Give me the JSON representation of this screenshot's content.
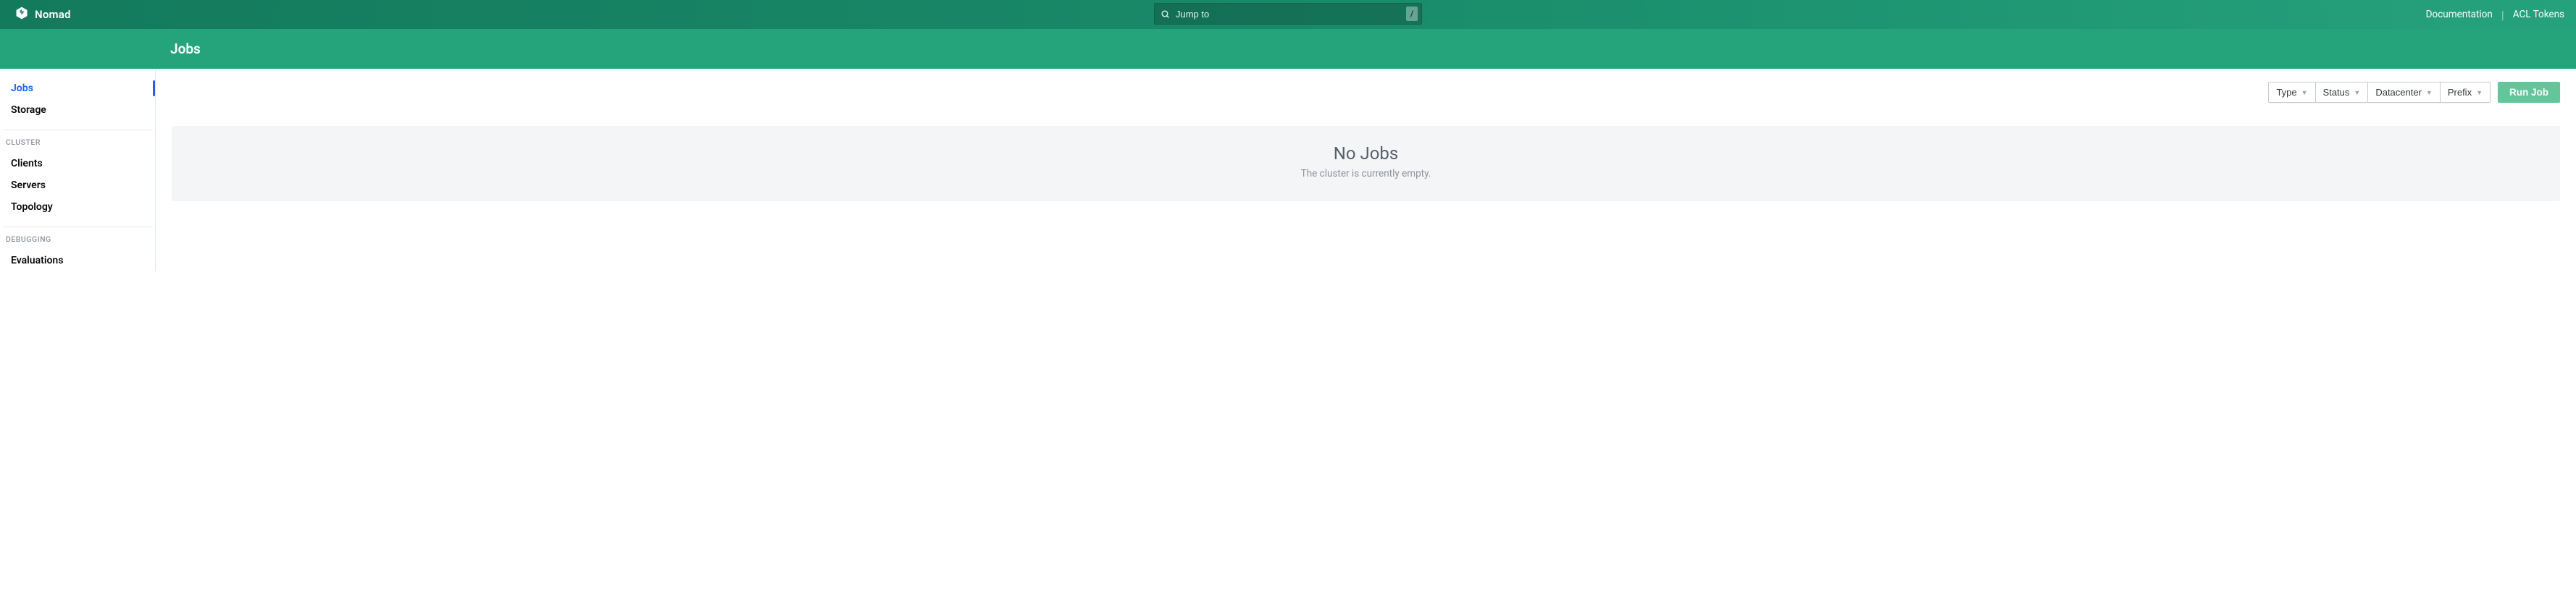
{
  "brand": {
    "name": "Nomad"
  },
  "search": {
    "placeholder": "Jump to",
    "value": "",
    "shortcut": "/"
  },
  "topnav_links": {
    "docs": "Documentation",
    "acl": "ACL Tokens"
  },
  "page": {
    "title": "Jobs"
  },
  "sidebar": {
    "workloads": [
      {
        "label": "Jobs",
        "active": true
      },
      {
        "label": "Storage",
        "active": false
      }
    ],
    "cluster_heading": "CLUSTER",
    "cluster": [
      {
        "label": "Clients"
      },
      {
        "label": "Servers"
      },
      {
        "label": "Topology"
      }
    ],
    "debugging_heading": "DEBUGGING",
    "debugging": [
      {
        "label": "Evaluations"
      }
    ]
  },
  "filters": {
    "type": "Type",
    "status": "Status",
    "datacenter": "Datacenter",
    "prefix": "Prefix"
  },
  "actions": {
    "run_job": "Run Job"
  },
  "empty_state": {
    "title": "No Jobs",
    "subtitle": "The cluster is currently empty."
  }
}
